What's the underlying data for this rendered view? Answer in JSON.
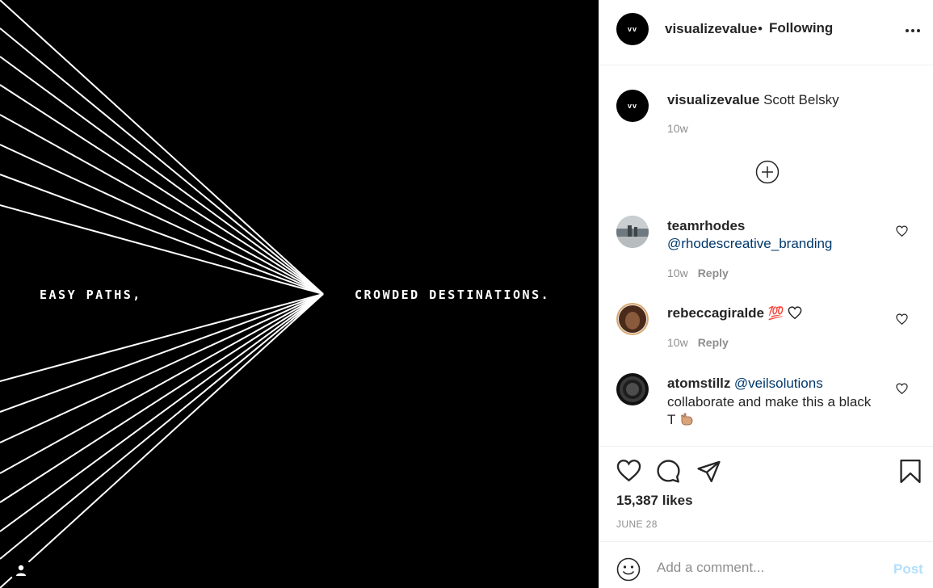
{
  "media": {
    "left_text": "EASY PATHS,",
    "right_text": "CROWDED DESTINATIONS."
  },
  "header": {
    "avatar_text": "vv",
    "username": "visualizevalue",
    "separator": "•",
    "follow_status": "Following",
    "more_icon": "more-dots-icon"
  },
  "caption": {
    "avatar_text": "vv",
    "username": "visualizevalue",
    "text": "Scott Belsky",
    "time": "10w"
  },
  "load_more_icon": "plus-circle-icon",
  "comments": [
    {
      "username": "teamrhodes",
      "mention": "@rhodescreative_branding",
      "time": "10w",
      "reply": "Reply"
    },
    {
      "username": "rebeccagiralde",
      "emoji": "💯",
      "time": "10w",
      "reply": "Reply"
    },
    {
      "username": "atomstillz",
      "mention": "@veilsolutions",
      "text_line1": "collaborate and make this a black",
      "text_line2": "T"
    }
  ],
  "post": {
    "likes": "15,387 likes",
    "date": "JUNE 28"
  },
  "comment_box": {
    "placeholder": "Add a comment...",
    "post_label": "Post"
  },
  "colors": {
    "link": "#00376b",
    "muted": "#8e8e8e",
    "post_disabled": "#b2dffc"
  }
}
